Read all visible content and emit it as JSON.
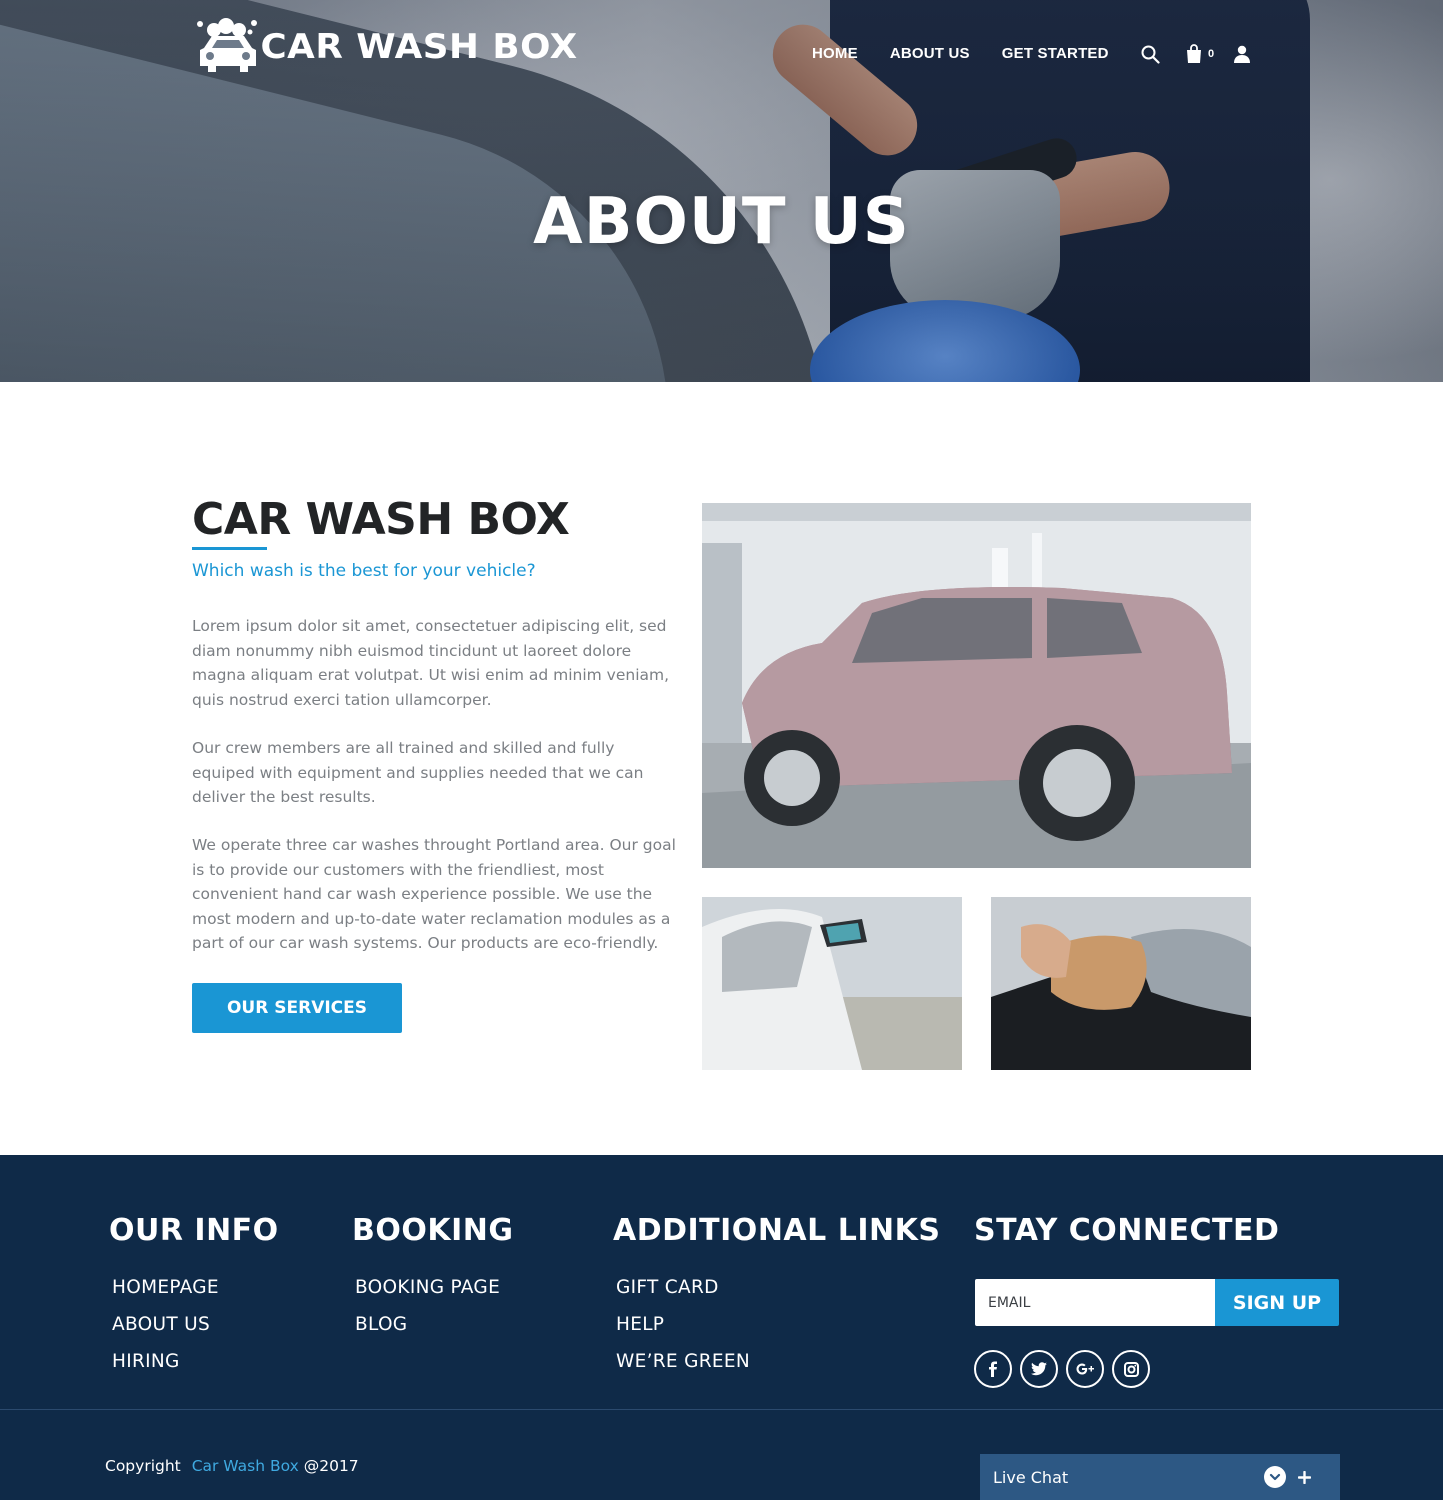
{
  "brand": {
    "name": "CAR WASH BOX"
  },
  "nav": {
    "items": [
      {
        "label": "HOME"
      },
      {
        "label": "ABOUT US"
      },
      {
        "label": "GET STARTED"
      }
    ],
    "cart_count": "0",
    "icons": [
      "search-icon",
      "cart-icon",
      "user-icon"
    ]
  },
  "hero": {
    "title": "ABOUT US"
  },
  "about": {
    "heading": "CAR WASH BOX",
    "subheading": "Which wash is the best for your vehicle?",
    "paragraphs": [
      "Lorem ipsum dolor sit amet, consectetuer adipiscing elit, sed diam nonummy nibh euismod tincidunt ut laoreet dolore magna aliquam erat volutpat. Ut wisi enim ad minim veniam, quis nostrud exerci tation ullamcorper.",
      "Our crew members are all trained and skilled and fully equiped with equipment and supplies needed that we can deliver the best results.",
      "We operate three car washes throught Portland area. Our goal is to provide our customers with the friendliest, most convenient hand car wash experience possible. We use the most modern and up-to-date water reclamation modules as a part of our car wash systems. Our products are eco-friendly."
    ],
    "button": "OUR SERVICES"
  },
  "footer": {
    "columns": [
      {
        "title": "OUR INFO",
        "links": [
          "HOMEPAGE",
          "ABOUT US",
          "HIRING"
        ]
      },
      {
        "title": "BOOKING",
        "links": [
          "BOOKING PAGE",
          "BLOG"
        ]
      },
      {
        "title": "ADDITIONAL LINKS",
        "links": [
          "GIFT CARD",
          "HELP",
          "WE’RE GREEN"
        ]
      },
      {
        "title": "STAY CONNECTED"
      }
    ],
    "email_placeholder": "EMAIL",
    "signup_label": "SIGN UP",
    "social": [
      "facebook-icon",
      "twitter-icon",
      "google-plus-icon",
      "instagram-icon"
    ],
    "copyright": {
      "prefix": "Copyright",
      "brand": "Car Wash Box",
      "suffix": "@2017"
    }
  },
  "live_chat": {
    "label": "Live Chat"
  },
  "colors": {
    "accent": "#1a96d4",
    "footer_bg": "#0f2a48",
    "live_chat_bg": "#2d5884",
    "heading": "#222426",
    "body_text": "#7b7f84"
  }
}
